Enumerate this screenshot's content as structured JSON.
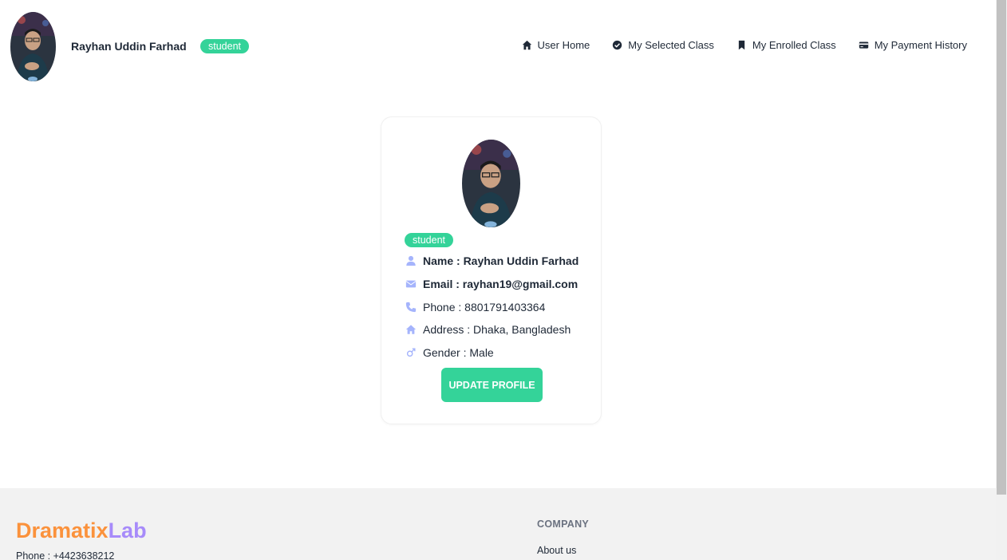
{
  "header": {
    "user_name": "Rayhan Uddin Farhad",
    "role_badge": "student",
    "nav": [
      {
        "label": "User Home",
        "icon": "home-icon"
      },
      {
        "label": "My Selected Class",
        "icon": "check-circle-icon"
      },
      {
        "label": "My Enrolled Class",
        "icon": "bookmark-icon"
      },
      {
        "label": "My Payment History",
        "icon": "credit-card-icon"
      }
    ]
  },
  "profile": {
    "role_badge": "student",
    "name": "Name : Rayhan Uddin Farhad",
    "email": "Email : rayhan19@gmail.com",
    "phone": "Phone : 8801791403364",
    "address": "Address : Dhaka, Bangladesh",
    "gender": "Gender : Male",
    "update_button": "UPDATE PROFILE"
  },
  "footer": {
    "brand_part1": "Dramatix",
    "brand_part2": "Lab",
    "phone": "Phone : +4423638212",
    "company_heading": "COMPANY",
    "links": [
      "About us"
    ]
  },
  "colors": {
    "accent_green": "#34d399",
    "brand_orange": "#fb923c",
    "brand_purple": "#a78bfa",
    "icon_lavender": "#a5b4fc"
  }
}
